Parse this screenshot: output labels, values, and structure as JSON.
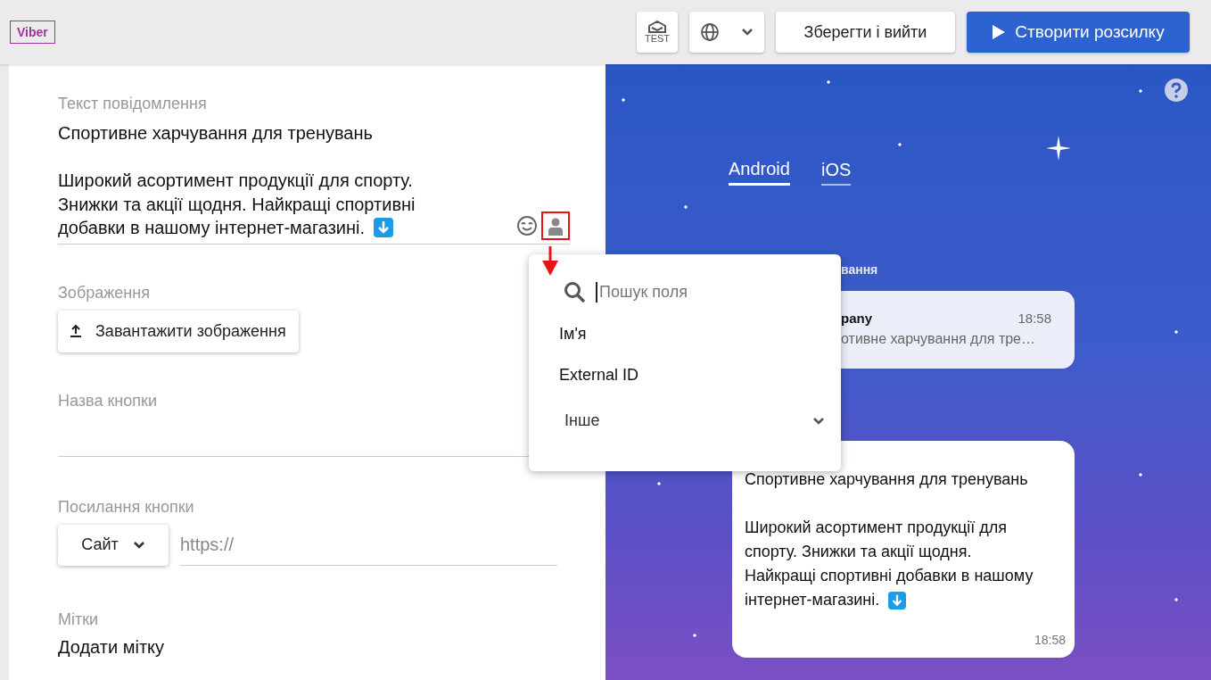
{
  "header": {
    "channel_badge": "Viber",
    "test_button": "TEST",
    "buttons": [
      {
        "label": "Зберегти і вийти",
        "kind": "secondary"
      },
      {
        "label": "Створити розсилку",
        "kind": "primary"
      }
    ]
  },
  "form": {
    "message": {
      "label": "Текст повідомлення",
      "value": "Спортивне харчування для тренувань\n\nШирокий асортимент продукції для спорту.\nЗнижки та акції щодня. Найкращі спортивні\nдобавки в нашому інтернет-магазині."
    },
    "image": {
      "label": "Зображення",
      "button": "Завантажити зображення"
    },
    "button_name": {
      "label": "Назва кнопки"
    },
    "button_link": {
      "label": "Посилання кнопки",
      "type": "Сайт",
      "placeholder": "https://"
    },
    "tags": {
      "label": "Мітки",
      "action": "Додати мітку"
    }
  },
  "field_menu": {
    "placeholder": "Пошук поля",
    "items": [
      {
        "label": "Ім'я",
        "kind": "field"
      },
      {
        "label": "External ID",
        "kind": "field"
      },
      {
        "label": "Інше",
        "kind": "group"
      }
    ]
  },
  "preview": {
    "tabs": [
      {
        "label": "Android",
        "selected": true
      },
      {
        "label": "iOS",
        "selected": false
      }
    ],
    "notification": {
      "header": "вання",
      "sender": "pany",
      "time": "18:58",
      "text": "отивне харчування для тре…"
    },
    "message": {
      "text": "Спортивне харчування для тренувань\n\nШирокий асортимент продукції для\nспорту. Знижки та акції щодня.\nНайкращі спортивні добавки в нашому\nінтернет-магазині.",
      "time": "18:58"
    }
  }
}
